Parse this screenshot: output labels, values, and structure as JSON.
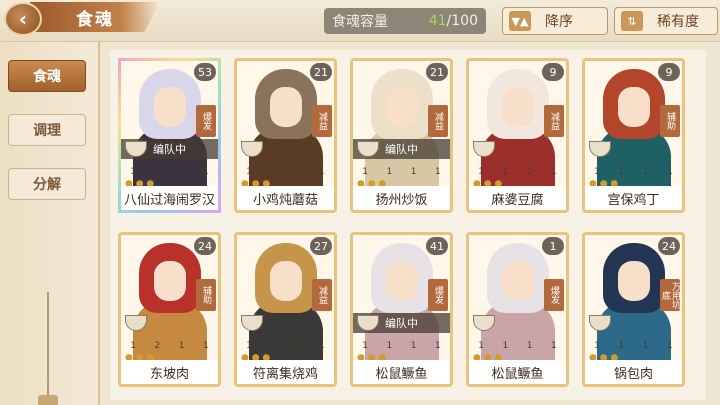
{
  "header": {
    "back_icon": "back-arrow-icon",
    "title": "食魂",
    "capacity_label": "食魂容量",
    "capacity_current": "41",
    "capacity_max": "/100",
    "sort_order_label": "降序",
    "sort_order_icon": "sort-arrows-icon",
    "sort_by_label": "稀有度",
    "sort_by_icon": "sort-swap-icon"
  },
  "sidebar": {
    "tabs": [
      {
        "label": "食魂",
        "active": true
      },
      {
        "label": "调理",
        "active": false
      },
      {
        "label": "分解",
        "active": false
      }
    ]
  },
  "cards": [
    {
      "name": "八仙过海闹罗汉",
      "level": "53",
      "role": "爆发",
      "team": "编队中",
      "stats": [
        "1",
        "1",
        "1",
        "1"
      ],
      "hair": "#d9d6ea",
      "body": "#3b3340",
      "rainbow": true
    },
    {
      "name": "小鸡炖蘑菇",
      "level": "21",
      "role": "减益",
      "team": "",
      "stats": [
        "1",
        "1",
        "1",
        "1"
      ],
      "hair": "#8a7358",
      "body": "#5a3c25",
      "rainbow": false
    },
    {
      "name": "扬州炒饭",
      "level": "21",
      "role": "减益",
      "team": "编队中",
      "stats": [
        "1",
        "1",
        "1",
        "1"
      ],
      "hair": "#ece0c8",
      "body": "#d8c7a4",
      "rainbow": false
    },
    {
      "name": "麻婆豆腐",
      "level": "9",
      "role": "减益",
      "team": "",
      "stats": [
        "1",
        "1",
        "2",
        "1"
      ],
      "hair": "#f1e7de",
      "body": "#9c2f2b",
      "rainbow": false
    },
    {
      "name": "宫保鸡丁",
      "level": "9",
      "role": "辅助",
      "team": "",
      "stats": [
        "1",
        "1",
        "1",
        "1"
      ],
      "hair": "#b3462a",
      "body": "#1f5f66",
      "rainbow": false
    },
    {
      "name": "东坡肉",
      "level": "24",
      "role": "辅助",
      "team": "",
      "stats": [
        "1",
        "2",
        "1",
        "1"
      ],
      "hair": "#b8312a",
      "body": "#c58a40",
      "rainbow": false
    },
    {
      "name": "符离集烧鸡",
      "level": "27",
      "role": "减益",
      "team": "",
      "stats": [
        "1",
        "1",
        "1",
        "1"
      ],
      "hair": "#c7944c",
      "body": "#3b3838",
      "rainbow": false
    },
    {
      "name": "松鼠鳜鱼",
      "level": "41",
      "role": "爆发",
      "team": "编队中",
      "stats": [
        "1",
        "1",
        "1",
        "1"
      ],
      "hair": "#e6e2e6",
      "body": "#c9a4a8",
      "rainbow": false
    },
    {
      "name": "松鼠鳜鱼",
      "level": "1",
      "role": "爆发",
      "team": "",
      "stats": [
        "1",
        "1",
        "1",
        "1"
      ],
      "hair": "#e6e2e6",
      "body": "#c9a4a8",
      "rainbow": false
    },
    {
      "name": "锅包肉",
      "level": "24",
      "role": "万用坑底",
      "team": "",
      "stats": [
        "1",
        "1",
        "1",
        "1"
      ],
      "hair": "#243553",
      "body": "#2d6a8a",
      "rainbow": false
    }
  ]
}
